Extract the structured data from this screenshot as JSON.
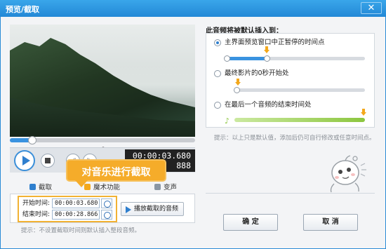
{
  "window": {
    "title": "预览/截取",
    "close_label": "✕"
  },
  "player": {
    "progress": 0.12,
    "time_current": "00:00:03.680",
    "time_total": "888",
    "collapse_glyph": "︿"
  },
  "callout": {
    "text": "对音乐进行截取"
  },
  "tabs": [
    {
      "label": "截取"
    },
    {
      "label": "魔术功能"
    },
    {
      "label": "变声"
    }
  ],
  "clip": {
    "start_label": "开始时间:",
    "start_value": "00:00:03.680",
    "end_label": "结束时间:",
    "end_value": "00:00:28.866",
    "preview_button": "播放截取的音频",
    "tip": "提示：不设置截取时间则默认插入整段音频。"
  },
  "insert": {
    "title": "此音频将被默认插入到：",
    "options": [
      {
        "label": "主界面预览窗口中正暂停的时间点",
        "selected": true
      },
      {
        "label": "最终影片的0秒开始处",
        "selected": false
      },
      {
        "label": "在最后一个音频的结束时间处",
        "selected": false
      }
    ],
    "option1_progress": 0.3,
    "tip": "提示：以上只是默认值，添加后仍可自行修改或任意时间点。"
  },
  "buttons": {
    "ok": "确 定",
    "cancel": "取 消"
  },
  "colors": {
    "accent": "#2f7fce",
    "callout": "#f5ac2a",
    "green": "#8cc63f"
  }
}
